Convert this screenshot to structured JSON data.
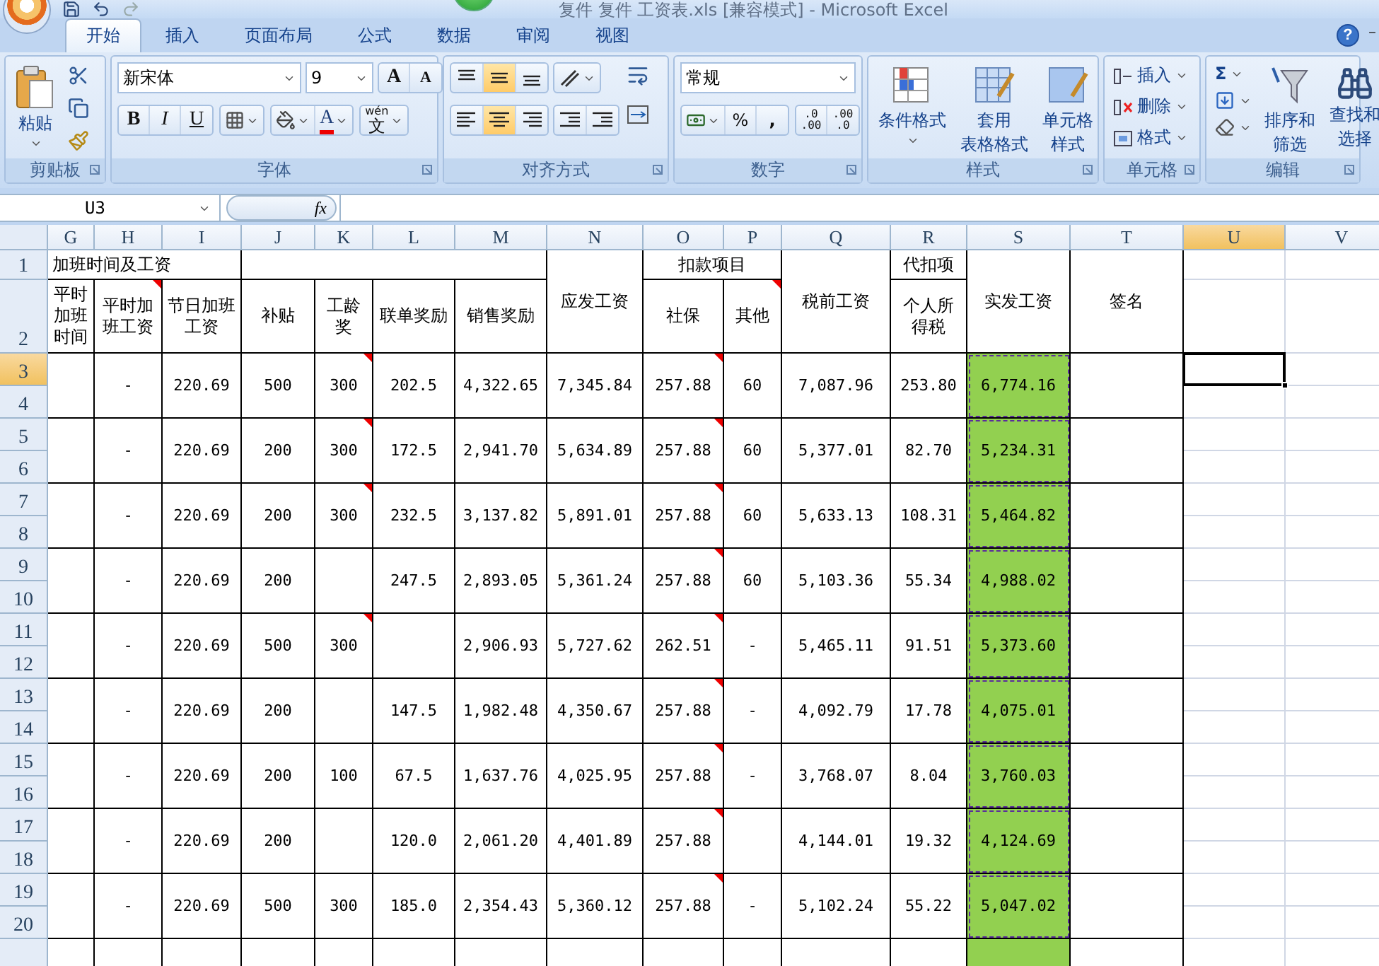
{
  "window": {
    "title": "复件 复件 工资表.xls  [兼容模式]  -  Microsoft Excel",
    "help": "?",
    "minimize": "–"
  },
  "tabs": [
    {
      "label": "开始",
      "selected": true
    },
    {
      "label": "插入",
      "selected": false
    },
    {
      "label": "页面布局",
      "selected": false
    },
    {
      "label": "公式",
      "selected": false
    },
    {
      "label": "数据",
      "selected": false
    },
    {
      "label": "审阅",
      "selected": false
    },
    {
      "label": "视图",
      "selected": false
    }
  ],
  "ribbon": {
    "clipboard": {
      "label": "剪贴板",
      "paste": "粘贴"
    },
    "font": {
      "label": "字体",
      "font_name": "新宋体",
      "font_size": "9",
      "grow": "A",
      "shrink": "A",
      "font_color": "A",
      "bold": "B",
      "italic": "I",
      "underline": "U",
      "phonetic_top": "wén",
      "phonetic": "文"
    },
    "alignment": {
      "label": "对齐方式",
      "vertical": [
        {
          "selected": false
        },
        {
          "selected": true
        },
        {
          "selected": false
        }
      ],
      "horizontal": [
        {
          "selected": false
        },
        {
          "selected": true
        },
        {
          "selected": false
        }
      ]
    },
    "number": {
      "label": "数字",
      "format": "常规",
      "percent": "%",
      "comma": ",",
      "increase_decimal": [
        ".0",
        ".00"
      ],
      "decrease_decimal": [
        ".00",
        ".0"
      ]
    },
    "styles": {
      "label": "样式",
      "conditional": "条件格式",
      "table_format": [
        "套用",
        "表格格式"
      ],
      "cell_styles": [
        "单元格",
        "样式"
      ]
    },
    "cells": {
      "label": "单元格",
      "insert": "插入",
      "delete": "删除",
      "format": "格式"
    },
    "editing": {
      "label": "编辑",
      "sum": "Σ",
      "sort": [
        "排序和",
        "筛选"
      ],
      "find": [
        "查找和",
        "选择"
      ]
    }
  },
  "formula_bar": {
    "name_box": "U3",
    "fx": "fx"
  },
  "sheet": {
    "net_pay_highlighted": true,
    "columns": [
      {
        "label": "G",
        "selected": false
      },
      {
        "label": "H",
        "selected": false
      },
      {
        "label": "I",
        "selected": false
      },
      {
        "label": "J",
        "selected": false
      },
      {
        "label": "K",
        "selected": false
      },
      {
        "label": "L",
        "selected": false
      },
      {
        "label": "M",
        "selected": false
      },
      {
        "label": "N",
        "selected": false
      },
      {
        "label": "O",
        "selected": false
      },
      {
        "label": "P",
        "selected": false
      },
      {
        "label": "Q",
        "selected": false
      },
      {
        "label": "R",
        "selected": false
      },
      {
        "label": "S",
        "selected": false
      },
      {
        "label": "T",
        "selected": false
      },
      {
        "label": "U",
        "selected": true
      },
      {
        "label": "V",
        "selected": false
      }
    ],
    "header_row_numbers": [
      "1",
      "2"
    ],
    "header": {
      "overtime": "加班时间及工资",
      "gross_pay": "应发工资",
      "deductions": "扣款项目",
      "pre_tax": "税前工资",
      "withheld": "代扣项",
      "net_pay": "实发工资",
      "signature": "签名",
      "subheads": [
        {
          "text": "平时加班时间",
          "comment": false
        },
        {
          "text": "平时加班工资",
          "comment": true
        },
        {
          "text": "节日加班工资",
          "comment": false
        },
        {
          "text": "补贴",
          "comment": false
        },
        {
          "text": "工龄奖",
          "comment": false
        },
        {
          "text": "联单奖励",
          "comment": false
        },
        {
          "text": "销售奖励",
          "comment": false
        }
      ],
      "social_security": {
        "text": "社保",
        "comment": false
      },
      "other": {
        "text": "其他",
        "comment": true
      },
      "income_tax": {
        "text": "个人所得税",
        "comment": false
      }
    },
    "rows": [
      {
        "row_numbers": [
          {
            "label": "3",
            "selected": true
          },
          {
            "label": "4",
            "selected": false
          }
        ],
        "cells": [
          null,
          "-",
          "220.69",
          "500",
          "300",
          "202.5",
          "4,322.65",
          "7,345.84",
          "257.88",
          "60",
          "7,087.96",
          "253.80",
          "6,774.16",
          null
        ],
        "comments": [
          false,
          false,
          false,
          false,
          true,
          false,
          false,
          false,
          true,
          false,
          false,
          false,
          false,
          false
        ]
      },
      {
        "row_numbers": [
          {
            "label": "5",
            "selected": false
          },
          {
            "label": "6",
            "selected": false
          }
        ],
        "cells": [
          null,
          "-",
          "220.69",
          "200",
          "300",
          "172.5",
          "2,941.70",
          "5,634.89",
          "257.88",
          "60",
          "5,377.01",
          "82.70",
          "5,234.31",
          null
        ],
        "comments": [
          false,
          false,
          false,
          false,
          true,
          false,
          false,
          false,
          true,
          false,
          false,
          false,
          false,
          false
        ]
      },
      {
        "row_numbers": [
          {
            "label": "7",
            "selected": false
          },
          {
            "label": "8",
            "selected": false
          }
        ],
        "cells": [
          null,
          "-",
          "220.69",
          "200",
          "300",
          "232.5",
          "3,137.82",
          "5,891.01",
          "257.88",
          "60",
          "5,633.13",
          "108.31",
          "5,464.82",
          null
        ],
        "comments": [
          false,
          false,
          false,
          false,
          true,
          false,
          false,
          false,
          true,
          false,
          false,
          false,
          false,
          false
        ]
      },
      {
        "row_numbers": [
          {
            "label": "9",
            "selected": false
          },
          {
            "label": "10",
            "selected": false
          }
        ],
        "cells": [
          null,
          "-",
          "220.69",
          "200",
          null,
          "247.5",
          "2,893.05",
          "5,361.24",
          "257.88",
          "60",
          "5,103.36",
          "55.34",
          "4,988.02",
          null
        ],
        "comments": [
          false,
          false,
          false,
          false,
          false,
          false,
          false,
          false,
          true,
          false,
          false,
          false,
          false,
          false
        ]
      },
      {
        "row_numbers": [
          {
            "label": "11",
            "selected": false
          },
          {
            "label": "12",
            "selected": false
          }
        ],
        "cells": [
          null,
          "-",
          "220.69",
          "500",
          "300",
          null,
          "2,906.93",
          "5,727.62",
          "262.51",
          "-",
          "5,465.11",
          "91.51",
          "5,373.60",
          null
        ],
        "comments": [
          false,
          false,
          false,
          false,
          true,
          false,
          false,
          false,
          true,
          false,
          false,
          false,
          false,
          false
        ]
      },
      {
        "row_numbers": [
          {
            "label": "13",
            "selected": false
          },
          {
            "label": "14",
            "selected": false
          }
        ],
        "cells": [
          null,
          "-",
          "220.69",
          "200",
          null,
          "147.5",
          "1,982.48",
          "4,350.67",
          "257.88",
          "-",
          "4,092.79",
          "17.78",
          "4,075.01",
          null
        ],
        "comments": [
          false,
          false,
          false,
          false,
          false,
          false,
          false,
          false,
          true,
          false,
          false,
          false,
          false,
          false
        ]
      },
      {
        "row_numbers": [
          {
            "label": "15",
            "selected": false
          },
          {
            "label": "16",
            "selected": false
          }
        ],
        "cells": [
          null,
          "-",
          "220.69",
          "200",
          "100",
          "67.5",
          "1,637.76",
          "4,025.95",
          "257.88",
          "-",
          "3,768.07",
          "8.04",
          "3,760.03",
          null
        ],
        "comments": [
          false,
          false,
          false,
          false,
          false,
          false,
          false,
          false,
          true,
          false,
          false,
          false,
          false,
          false
        ]
      },
      {
        "row_numbers": [
          {
            "label": "17",
            "selected": false
          },
          {
            "label": "18",
            "selected": false
          }
        ],
        "cells": [
          null,
          "-",
          "220.69",
          "200",
          null,
          "120.0",
          "2,061.20",
          "4,401.89",
          "257.88",
          null,
          "4,144.01",
          "19.32",
          "4,124.69",
          null
        ],
        "comments": [
          false,
          false,
          false,
          false,
          false,
          false,
          false,
          false,
          true,
          false,
          false,
          false,
          false,
          false
        ]
      },
      {
        "row_numbers": [
          {
            "label": "19",
            "selected": false
          },
          {
            "label": "20",
            "selected": false
          }
        ],
        "cells": [
          null,
          "-",
          "220.69",
          "500",
          "300",
          "185.0",
          "2,354.43",
          "5,360.12",
          "257.88",
          "-",
          "5,102.24",
          "55.22",
          "5,047.02",
          null
        ],
        "comments": [
          false,
          false,
          false,
          false,
          false,
          false,
          false,
          false,
          true,
          false,
          false,
          false,
          false,
          false
        ]
      }
    ]
  }
}
